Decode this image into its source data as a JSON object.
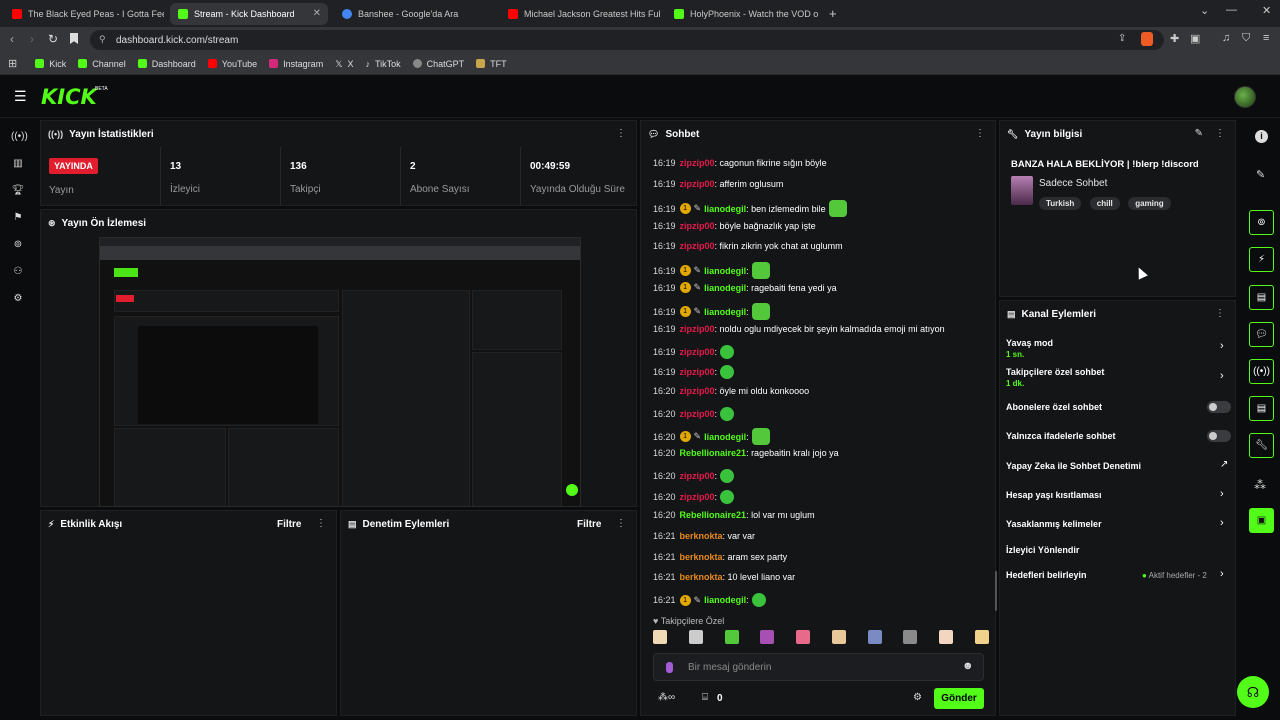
{
  "browser": {
    "tabs": [
      {
        "label": "The Black Eyed Peas - I Gotta Feeling",
        "color": "#ff0000"
      },
      {
        "label": "Stream - Kick Dashboard",
        "color": "#53fc18"
      },
      {
        "label": "Banshee - Google'da Ara",
        "color": "#4285f4"
      },
      {
        "label": "Michael Jackson Greatest Hits Ful",
        "color": "#ff0000"
      },
      {
        "label": "HolyPhoenix - Watch the VOD on Ki",
        "color": "#53fc18"
      }
    ],
    "url": "dashboard.kick.com/stream",
    "bookmarks": [
      "Kick",
      "Channel",
      "Dashboard",
      "YouTube",
      "Instagram",
      "X",
      "TikTok",
      "ChatGPT",
      "TFT"
    ]
  },
  "app": {
    "logo": "KICK",
    "beta": "BETA"
  },
  "stats": {
    "title": "Yayın İstatistikleri",
    "live_badge": "YAYINDA",
    "live_label": "Yayın",
    "items": [
      {
        "value": "13",
        "label": "İzleyici"
      },
      {
        "value": "136",
        "label": "Takipçi"
      },
      {
        "value": "2",
        "label": "Abone Sayısı"
      },
      {
        "value": "00:49:59",
        "label": "Yayında Olduğu Süre"
      }
    ]
  },
  "preview": {
    "title": "Yayın Ön İzlemesi"
  },
  "activity": {
    "title": "Etkinlik Akışı",
    "filter": "Filtre"
  },
  "moderation": {
    "title": "Denetim Eylemleri",
    "filter": "Filtre"
  },
  "chat": {
    "title": "Sohbet",
    "messages": [
      {
        "time": "16:19",
        "user": "zipzip00",
        "style": "u1",
        "text": ": cagonun fikrine sığın böyle"
      },
      {
        "time": "16:19",
        "user": "zipzip00",
        "style": "u1",
        "text": ": afferim oglusum"
      },
      {
        "time": "16:19",
        "user": "lianodegil",
        "style": "u2",
        "badge": true,
        "text": ": ben izlemedim bile",
        "emote": true
      },
      {
        "time": "16:19",
        "user": "zipzip00",
        "style": "u1",
        "text": ": böyle bağnazlık yap işte"
      },
      {
        "time": "16:19",
        "user": "zipzip00",
        "style": "u1",
        "text": ": fikrin zikrin yok chat at uglumm"
      },
      {
        "time": "16:19",
        "user": "lianodegil",
        "style": "u2",
        "badge": true,
        "text": ":",
        "emote": true
      },
      {
        "time": "16:19",
        "user": "lianodegil",
        "style": "u2",
        "badge": true,
        "text": ": ragebaiti fena yedi ya"
      },
      {
        "time": "16:19",
        "user": "lianodegil",
        "style": "u2",
        "badge": true,
        "text": ":",
        "emote": true
      },
      {
        "time": "16:19",
        "user": "zipzip00",
        "style": "u1",
        "text": ": noldu oglu mdiyecek bir şeyin kalmadıda emoji mi atıyon"
      },
      {
        "time": "16:19",
        "user": "zipzip00",
        "style": "u1",
        "text": ":",
        "emote_sm": true
      },
      {
        "time": "16:19",
        "user": "zipzip00",
        "style": "u1",
        "text": ":",
        "emote_sm": true
      },
      {
        "time": "16:20",
        "user": "zipzip00",
        "style": "u1",
        "text": ": öyle mi oldu konkoooo"
      },
      {
        "time": "16:20",
        "user": "zipzip00",
        "style": "u1",
        "text": ":",
        "emote_sm": true
      },
      {
        "time": "16:20",
        "user": "lianodegil",
        "style": "u2",
        "badge": true,
        "text": ":",
        "emote": true
      },
      {
        "time": "16:20",
        "user": "Rebellionaire21",
        "style": "u3",
        "text": ": ragebaitin kralı jojo ya"
      },
      {
        "time": "16:20",
        "user": "zipzip00",
        "style": "u1",
        "text": ":",
        "emote_sm": true
      },
      {
        "time": "16:20",
        "user": "zipzip00",
        "style": "u1",
        "text": ":",
        "emote_sm": true
      },
      {
        "time": "16:20",
        "user": "Rebellionaire21",
        "style": "u3",
        "text": ": lol var mı uglum"
      },
      {
        "time": "16:21",
        "user": "berknokta",
        "style": "u4",
        "text": ": var var"
      },
      {
        "time": "16:21",
        "user": "berknokta",
        "style": "u4",
        "text": ": aram sex party"
      },
      {
        "time": "16:21",
        "user": "berknokta",
        "style": "u4",
        "text": ": 10 level liano var"
      },
      {
        "time": "16:21",
        "user": "lianodegil",
        "style": "u2",
        "badge": true,
        "text": ":",
        "emote_sm": true
      }
    ],
    "followers_only_label": "Takipçilere Özel",
    "input_placeholder": "Bir mesaj gönderin",
    "points": "0",
    "send": "Gönder"
  },
  "stream_info": {
    "title": "Yayın bilgisi",
    "stream_title": "BANZA HALA BEKLİYOR | !blerp !discord",
    "category": "Sadece Sohbet",
    "tags": [
      "Turkish",
      "chill",
      "gaming"
    ]
  },
  "channel_actions": {
    "title": "Kanal Eylemleri",
    "slow_mode": {
      "label": "Yavaş mod",
      "value": "1 sn."
    },
    "followers_chat": {
      "label": "Takipçilere özel sohbet",
      "value": "1 dk."
    },
    "subs_chat": "Abonelere özel sohbet",
    "emotes_chat": "Yalnızca ifadelerle sohbet",
    "ai_mod": "Yapay Zeka ile Sohbet Denetimi",
    "age": "Hesap yaşı kısıtlaması",
    "banned_words": "Yasaklanmış kelimeler",
    "redirect": "İzleyici Yönlendir",
    "goals": "Hedefleri belirleyin",
    "goals_status": "Aktif hedefler - 2"
  }
}
